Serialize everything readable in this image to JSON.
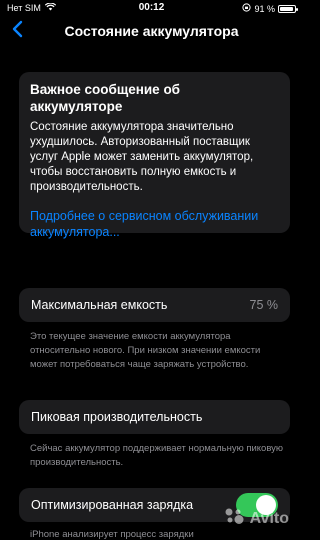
{
  "status_bar": {
    "carrier": "Нет SIM",
    "time": "00:12",
    "battery_percent_text": "91 %",
    "battery_level": 0.91
  },
  "nav": {
    "title": "Состояние аккумулятора",
    "back_icon": "chevron-left-icon"
  },
  "message": {
    "title": "Важное сообщение об аккумуляторе",
    "body": "Состояние аккумулятора значительно ухудшилось. Авторизованный поставщик услуг Apple может заменить аккумулятор, чтобы восстановить полную емкость и производительность.",
    "link": "Подробнее о сервисном обслуживании аккумулятора..."
  },
  "max_capacity": {
    "label": "Максимальная емкость",
    "value": "75 %",
    "footnote": "Это текущее значение емкости аккумулятора относительно нового. При низком значении емкости может потребоваться чаще заряжать устройство."
  },
  "peak_performance": {
    "label": "Пиковая производительность",
    "footnote": "Сейчас аккумулятор поддерживает нормальную пиковую производительность."
  },
  "optimized_charging": {
    "label": "Оптимизированная зарядка",
    "enabled": true,
    "footnote": "iPhone анализирует процесс зарядки"
  },
  "watermark": {
    "text": "Avito"
  },
  "colors": {
    "accent": "#0a84ff",
    "toggle_on": "#34c759",
    "cell_bg": "#1c1c1e"
  }
}
